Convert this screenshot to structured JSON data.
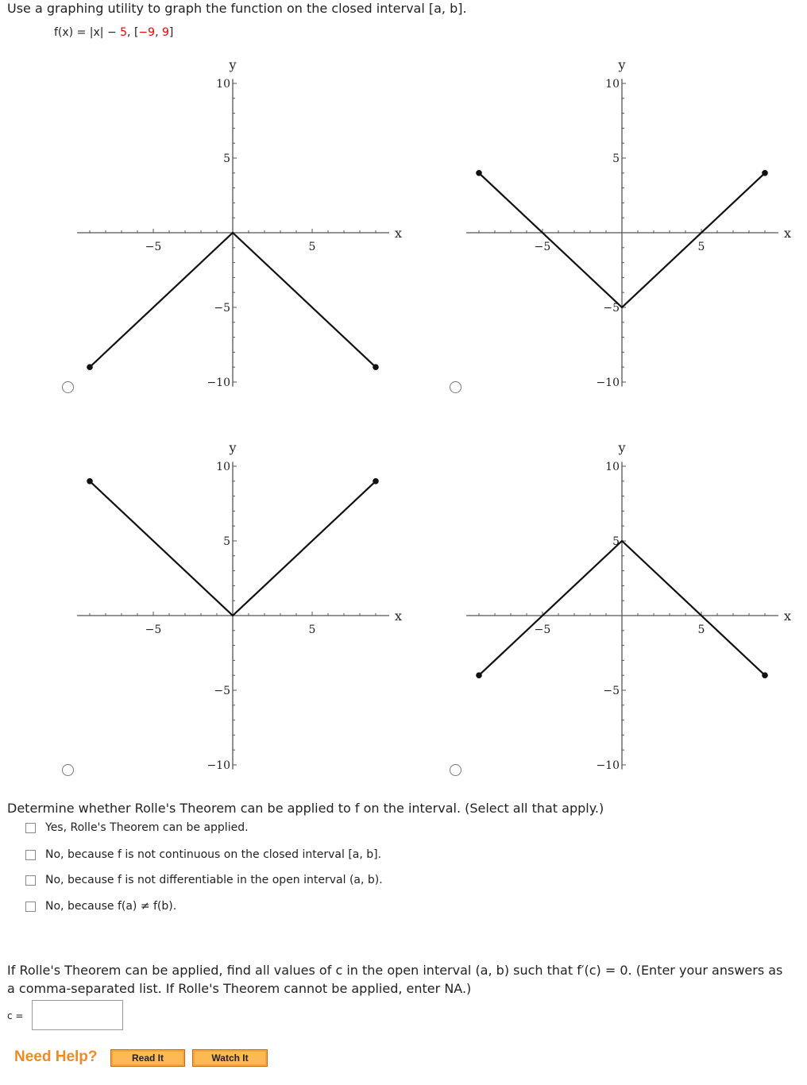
{
  "question": {
    "instruction_pre": "Use a graphing utility to graph the function on the closed interval ",
    "interval_label": "[a, b]",
    "instruction_post": ".",
    "function_lhs": "f(x) = |x| − ",
    "function_const": "5",
    "function_sep": ",   [",
    "interval_a": "−9",
    "interval_comma": ", ",
    "interval_b": "9",
    "interval_close": "]"
  },
  "graph_options": {
    "axis_labels": {
      "x": "x",
      "y": "y"
    },
    "x_tick_labels": [
      "−5",
      "5"
    ],
    "y_tick_labels": [
      "10",
      "5",
      "−5",
      "−10"
    ]
  },
  "chart_data": [
    {
      "type": "line",
      "name": "option-1",
      "function": "-|x|",
      "points": [
        [
          -9,
          -9
        ],
        [
          0,
          0
        ],
        [
          9,
          -9
        ]
      ],
      "endpoints_marked": true,
      "xlim": [
        -9.8,
        10
      ],
      "ylim": [
        -10,
        10
      ],
      "xticks": [
        -5,
        5
      ],
      "yticks": [
        10,
        5,
        -5,
        -10
      ],
      "xlabel": "x",
      "ylabel": "y",
      "selected": false
    },
    {
      "type": "line",
      "name": "option-2",
      "function": "|x|-5",
      "points": [
        [
          -9,
          4
        ],
        [
          0,
          -5
        ],
        [
          9,
          4
        ]
      ],
      "endpoints_marked": true,
      "xlim": [
        -9.8,
        10
      ],
      "ylim": [
        -10,
        10
      ],
      "xticks": [
        -5,
        5
      ],
      "yticks": [
        10,
        5,
        -5,
        -10
      ],
      "xlabel": "x",
      "ylabel": "y",
      "selected": false
    },
    {
      "type": "line",
      "name": "option-3",
      "function": "|x|",
      "points": [
        [
          -9,
          9
        ],
        [
          0,
          0
        ],
        [
          9,
          9
        ]
      ],
      "endpoints_marked": true,
      "xlim": [
        -9.8,
        10
      ],
      "ylim": [
        -10,
        10
      ],
      "xticks": [
        -5,
        5
      ],
      "yticks": [
        10,
        5,
        -5,
        -10
      ],
      "xlabel": "x",
      "ylabel": "y",
      "selected": false
    },
    {
      "type": "line",
      "name": "option-4",
      "function": "5-|x|",
      "points": [
        [
          -9,
          -4
        ],
        [
          0,
          5
        ],
        [
          9,
          -4
        ]
      ],
      "endpoints_marked": true,
      "xlim": [
        -9.8,
        10
      ],
      "ylim": [
        -10,
        10
      ],
      "xticks": [
        -5,
        5
      ],
      "yticks": [
        10,
        5,
        -5,
        -10
      ],
      "xlabel": "x",
      "ylabel": "y",
      "selected": false
    }
  ],
  "rolle": {
    "prompt": "Determine whether Rolle's Theorem can be applied to f on the interval. (Select all that apply.)",
    "options": [
      {
        "label": "Yes, Rolle's Theorem can be applied.",
        "checked": false
      },
      {
        "label": "No, because f is not continuous on the closed interval [a, b].",
        "checked": false
      },
      {
        "label": "No, because f is not differentiable in the open interval (a, b).",
        "checked": false
      },
      {
        "label": "No, because f(a) ≠ f(b).",
        "checked": false
      }
    ]
  },
  "find_c": {
    "prompt": "If Rolle's Theorem can be applied, find all values of c in the open interval (a, b) such that f′(c) = 0. (Enter your answers as a comma-separated list. If Rolle's Theorem cannot be applied, enter NA.)",
    "label": "c =",
    "value": ""
  },
  "help": {
    "label": "Need Help?",
    "read_it": "Read It",
    "watch_it": "Watch It",
    "accent": "#f08a24"
  }
}
